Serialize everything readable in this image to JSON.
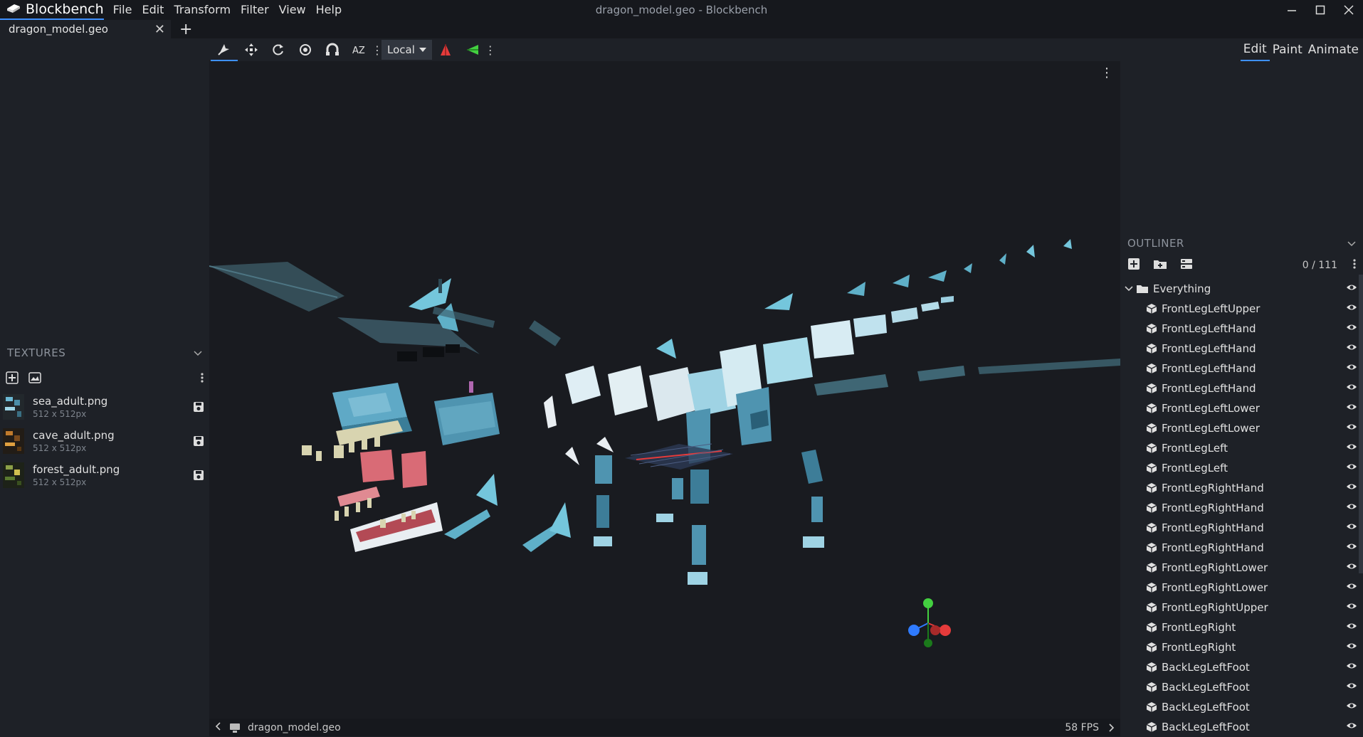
{
  "app": {
    "name": "Blockbench",
    "window_title": "dragon_model.geo - Blockbench",
    "menu": [
      "File",
      "Edit",
      "Transform",
      "Filter",
      "View",
      "Help"
    ]
  },
  "tabs": [
    {
      "label": "dragon_model.geo"
    }
  ],
  "toolbar": {
    "space": "Local",
    "tools": [
      "move-tool-icon",
      "resize-icon",
      "rotate-icon",
      "pivot-icon",
      "vertex-snap-icon",
      "sort-az-icon"
    ]
  },
  "modes": [
    "Edit",
    "Paint",
    "Animate"
  ],
  "textures": {
    "title": "TEXTURES",
    "items": [
      {
        "name": "sea_adult.png",
        "size": "512 x 512px"
      },
      {
        "name": "cave_adult.png",
        "size": "512 x 512px"
      },
      {
        "name": "forest_adult.png",
        "size": "512 x 512px"
      }
    ]
  },
  "outliner": {
    "title": "OUTLINER",
    "count": "0 / 111",
    "group": "Everything",
    "items": [
      "FrontLegLeftUpper",
      "FrontLegLeftHand",
      "FrontLegLeftHand",
      "FrontLegLeftHand",
      "FrontLegLeftHand",
      "FrontLegLeftLower",
      "FrontLegLeftLower",
      "FrontLegLeft",
      "FrontLegLeft",
      "FrontLegRightHand",
      "FrontLegRightHand",
      "FrontLegRightHand",
      "FrontLegRightHand",
      "FrontLegRightLower",
      "FrontLegRightLower",
      "FrontLegRightUpper",
      "FrontLegRight",
      "FrontLegRight",
      "BackLegLeftFoot",
      "BackLegLeftFoot",
      "BackLegLeftFoot",
      "BackLegLeftFoot"
    ]
  },
  "status": {
    "file": "dragon_model.geo",
    "fps": "58 FPS"
  },
  "colors": {
    "accent": "#3e90ff",
    "axis_x": "#e53b3b",
    "axis_y": "#43d040",
    "axis_z": "#2f7bff",
    "model_blue": "#5fa9c6"
  }
}
